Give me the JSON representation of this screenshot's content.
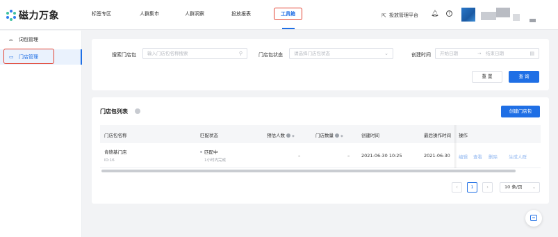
{
  "brand": {
    "name": "磁力万象"
  },
  "header": {
    "nav": [
      "标签专区",
      "人群集市",
      "人群洞察",
      "投放报表",
      "工具箱"
    ],
    "active_nav": "工具箱",
    "platform_link": "投放管理平台",
    "icons": [
      "bell-icon",
      "help-icon",
      "avatar"
    ]
  },
  "sidebar": {
    "items": [
      {
        "icon": "word-pack-icon",
        "label": "词包管理"
      },
      {
        "icon": "store-icon",
        "label": "门店管理"
      }
    ],
    "active": "门店管理"
  },
  "filters": {
    "search_label": "搜索门店包",
    "search_placeholder": "输入门店包名称搜索",
    "status_label": "门店包状态",
    "status_placeholder": "请选择门店包状态",
    "created_label": "创建时间",
    "start_placeholder": "开始日期",
    "range_separator": "→",
    "end_placeholder": "结束日期",
    "reset": "重 置",
    "search": "查 询"
  },
  "list": {
    "title": "门店包列表",
    "create_button": "创建门店包",
    "columns": [
      "门店包名称",
      "匹配状态",
      "预估人数",
      "门店数量",
      "创建时间",
      "最后操作时间",
      "操作"
    ],
    "rows": [
      {
        "name": "肯德基门店",
        "id": "ID:16",
        "status": "匹配中",
        "status_sub": "1小时内完成",
        "estimated": "–",
        "store_count": "–",
        "created": "2021-06-30 10:25",
        "updated": "2021-06-30",
        "actions": [
          "编辑",
          "查看",
          "删除",
          "生成人群"
        ]
      }
    ]
  },
  "pagination": {
    "prev": "‹",
    "current_page": "1",
    "next": "›",
    "page_size": "10 条/页"
  },
  "colors": {
    "accent": "#1f6fe5",
    "highlight": "#e2402f"
  }
}
